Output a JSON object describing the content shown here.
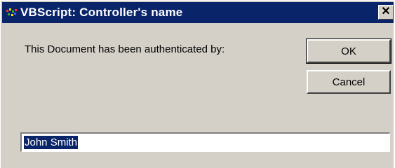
{
  "window": {
    "title": "VBScript: Controller's name",
    "close_glyph": "✕"
  },
  "dialog": {
    "prompt": "This Document has been authenticated by:",
    "ok_label": "OK",
    "cancel_label": "Cancel",
    "input_value": "John Smith"
  },
  "colors": {
    "titlebar": "#0a246a",
    "face": "#d4d0c8",
    "selection": "#0a246a"
  },
  "icons": [
    "app-icon",
    "close-icon"
  ]
}
